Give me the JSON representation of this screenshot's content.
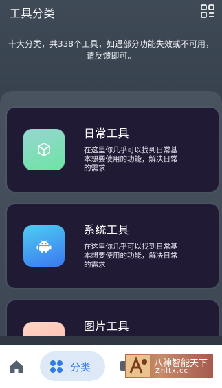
{
  "header": {
    "title": "工具分类",
    "grid_icon": "grid-menu-icon"
  },
  "subtitle": "十大分类，共338个工具，如遇部分功能失效或不可用，请反馈即可。",
  "categories": [
    {
      "title": "日常工具",
      "description": "在这里你几乎可以找到日常基本想要使用的功能，解决日常的需求",
      "icon": "cube-icon",
      "colors": [
        "#8fd8c4",
        "#6ee2a8"
      ]
    },
    {
      "title": "系统工具",
      "description": "在这里你几乎可以找到日常基本想要使用的功能，解决日常的需求",
      "icon": "android-icon",
      "colors": [
        "#4fc8f0",
        "#3b7ff0"
      ]
    },
    {
      "title": "图片工具",
      "description": "",
      "icon": "image-icon",
      "colors": [
        "#ffd3c0",
        "#ffb8b0"
      ]
    }
  ],
  "bottom_nav": {
    "home_icon": "home-icon",
    "category_label": "分类",
    "category_icon": "four-dots-icon"
  },
  "watermark": {
    "line1": "八神智能天下",
    "line2": "Znltx.cc"
  },
  "colors": {
    "accent": "#2f7ae5",
    "card_bg": "#201a35"
  }
}
